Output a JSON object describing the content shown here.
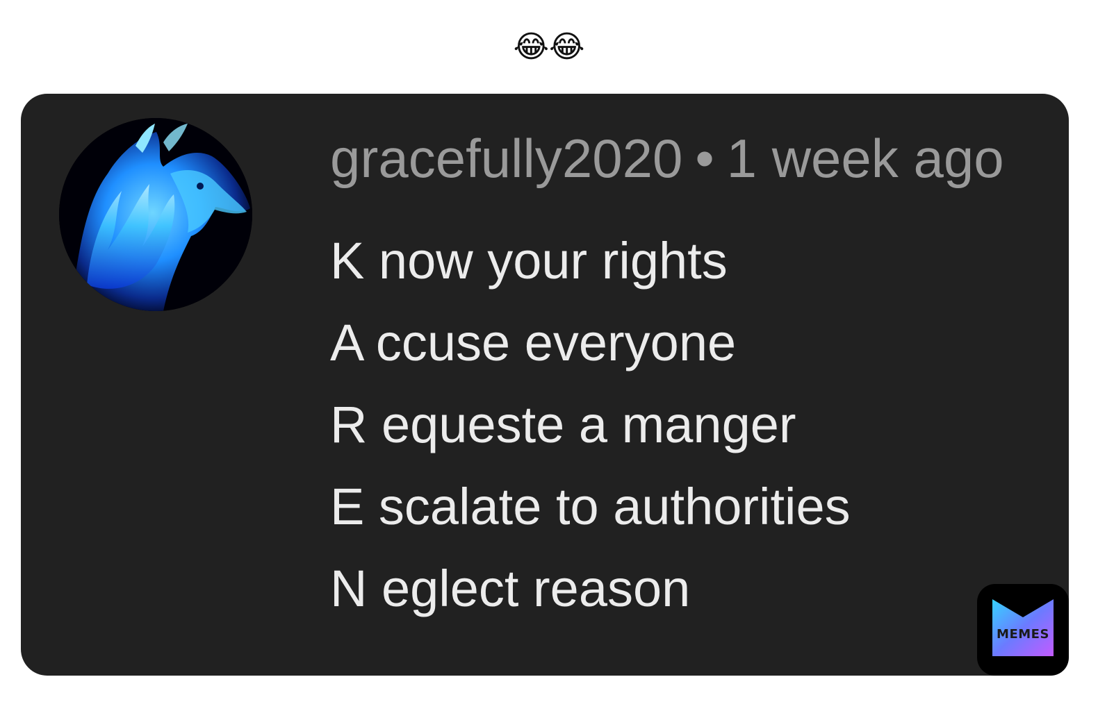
{
  "caption": "😂😂",
  "comment": {
    "username": "gracefully2020",
    "separator": "•",
    "timestamp": "1 week ago",
    "avatar_icon": "blue-flame-horse-icon",
    "lines": [
      "K now your rights",
      "A ccuse everyone",
      "R equeste a manger",
      "E scalate to authorities",
      "N eglect reason"
    ]
  },
  "watermark": {
    "label": "MEMES",
    "icon": "memes-logo-icon"
  },
  "colors": {
    "card_background": "#212121",
    "username_text": "#9a9a9a",
    "comment_text": "#ececec",
    "avatar_accent": "#2aa8ff"
  }
}
